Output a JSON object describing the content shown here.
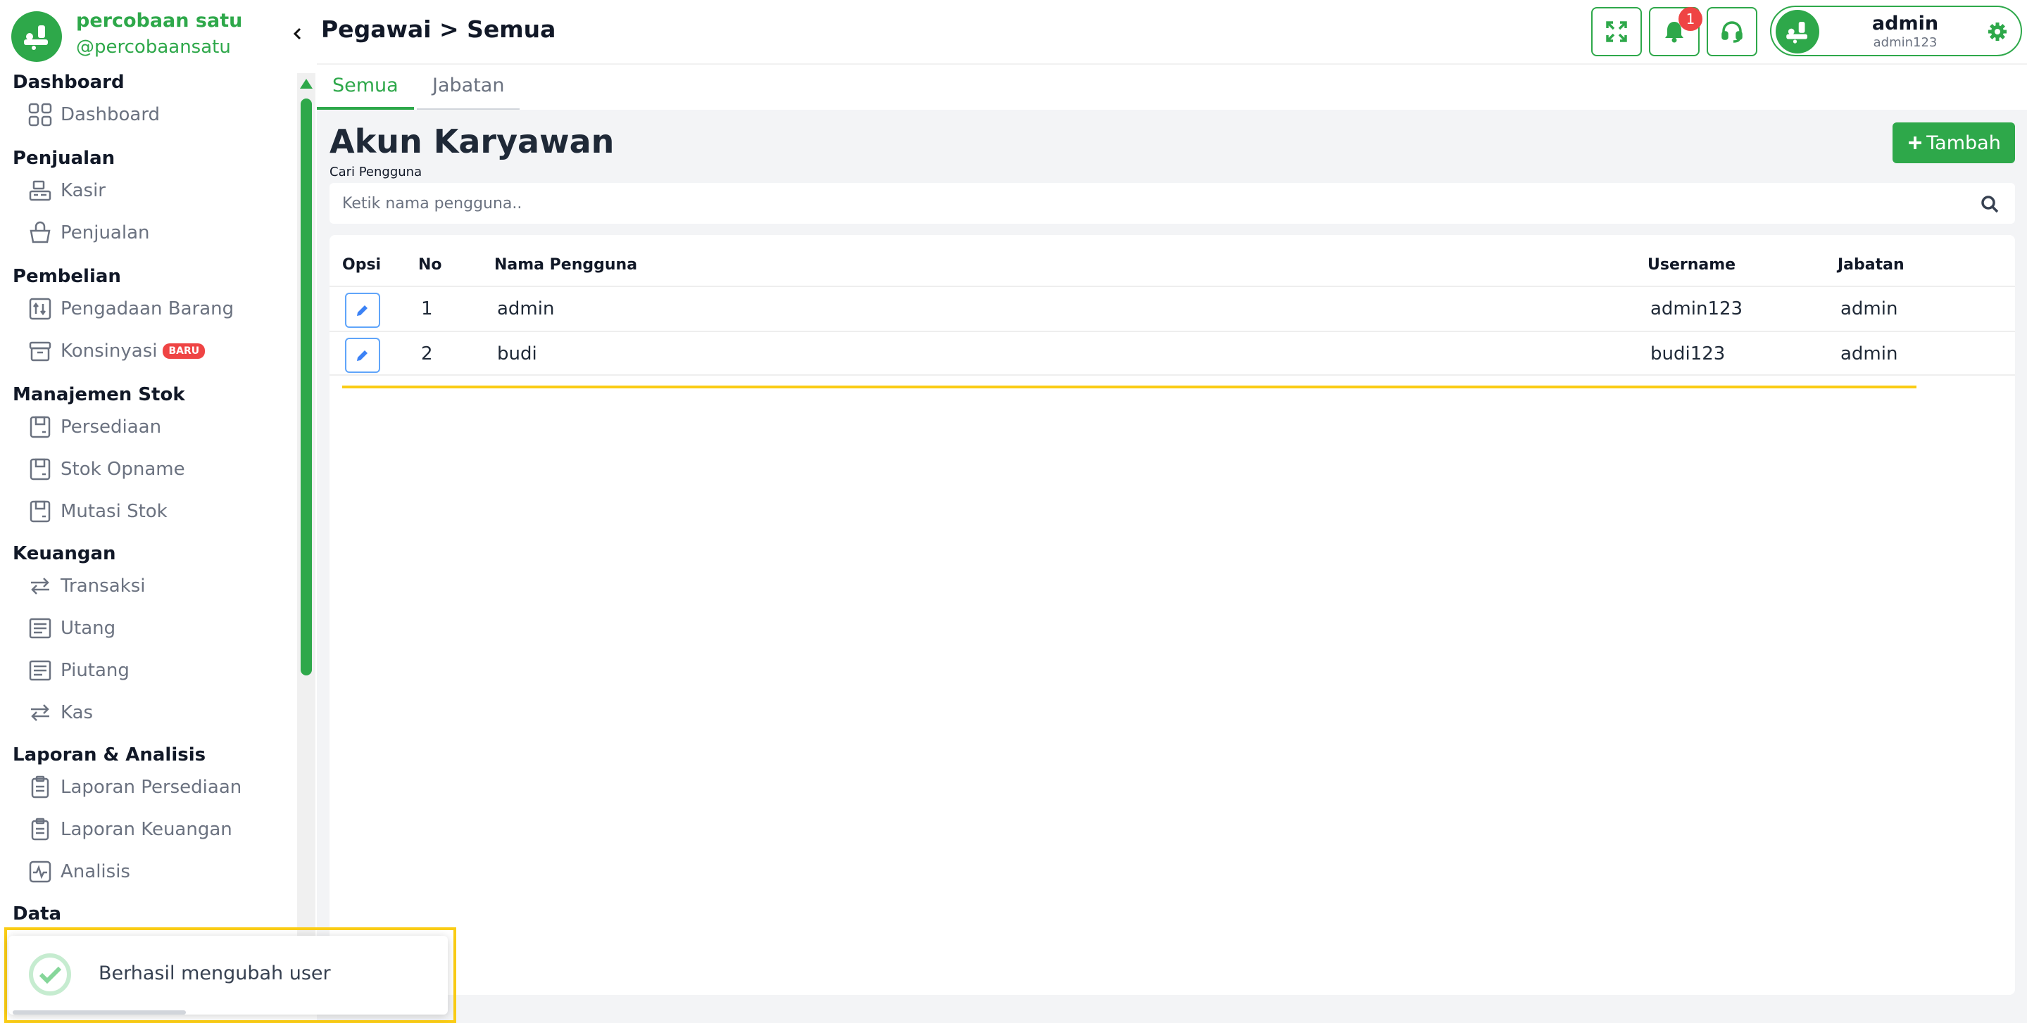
{
  "brand": {
    "name": "percobaan satu",
    "handle": "@percobaansatu"
  },
  "sidebar": {
    "sections": [
      {
        "title": "Dashboard",
        "items": [
          {
            "label": "Dashboard",
            "icon": "grid-icon"
          }
        ]
      },
      {
        "title": "Penjualan",
        "items": [
          {
            "label": "Kasir",
            "icon": "cash-register-icon"
          },
          {
            "label": "Penjualan",
            "icon": "basket-icon"
          }
        ]
      },
      {
        "title": "Pembelian",
        "items": [
          {
            "label": "Pengadaan Barang",
            "icon": "procurement-icon"
          },
          {
            "label": "Konsinyasi",
            "icon": "archive-icon",
            "badge": "BARU"
          }
        ]
      },
      {
        "title": "Manajemen Stok",
        "items": [
          {
            "label": "Persediaan",
            "icon": "inventory-icon"
          },
          {
            "label": "Stok Opname",
            "icon": "inventory-icon"
          },
          {
            "label": "Mutasi Stok",
            "icon": "inventory-icon"
          }
        ]
      },
      {
        "title": "Keuangan",
        "items": [
          {
            "label": "Transaksi",
            "icon": "transfer-icon"
          },
          {
            "label": "Utang",
            "icon": "document-list-icon"
          },
          {
            "label": "Piutang",
            "icon": "document-list-icon"
          },
          {
            "label": "Kas",
            "icon": "transfer-icon"
          }
        ]
      },
      {
        "title": "Laporan & Analisis",
        "items": [
          {
            "label": "Laporan Persediaan",
            "icon": "clipboard-icon"
          },
          {
            "label": "Laporan Keuangan",
            "icon": "clipboard-icon"
          },
          {
            "label": "Analisis",
            "icon": "activity-icon"
          }
        ]
      },
      {
        "title": "Data",
        "items": []
      }
    ]
  },
  "header": {
    "breadcrumb": "Pegawai > Semua",
    "notification_count": "1",
    "user": {
      "name": "admin",
      "username": "admin123"
    }
  },
  "tabs": [
    {
      "label": "Semua",
      "active": true
    },
    {
      "label": "Jabatan",
      "active": false
    }
  ],
  "main": {
    "title": "Akun Karyawan",
    "add_button": "Tambah",
    "search_label": "Cari Pengguna",
    "search_placeholder": "Ketik nama pengguna..",
    "table": {
      "headers": [
        "Opsi",
        "No",
        "Nama Pengguna",
        "Username",
        "Jabatan"
      ],
      "rows": [
        {
          "no": "1",
          "nama": "admin",
          "username": "admin123",
          "jabatan": "admin"
        },
        {
          "no": "2",
          "nama": "budi",
          "username": "budi123",
          "jabatan": "admin"
        }
      ]
    }
  },
  "toast": {
    "message": "Berhasil mengubah user"
  },
  "colors": {
    "primary": "#2ea84a",
    "danger": "#ef4444",
    "highlight": "#facc15",
    "edit": "#3b82f6"
  }
}
